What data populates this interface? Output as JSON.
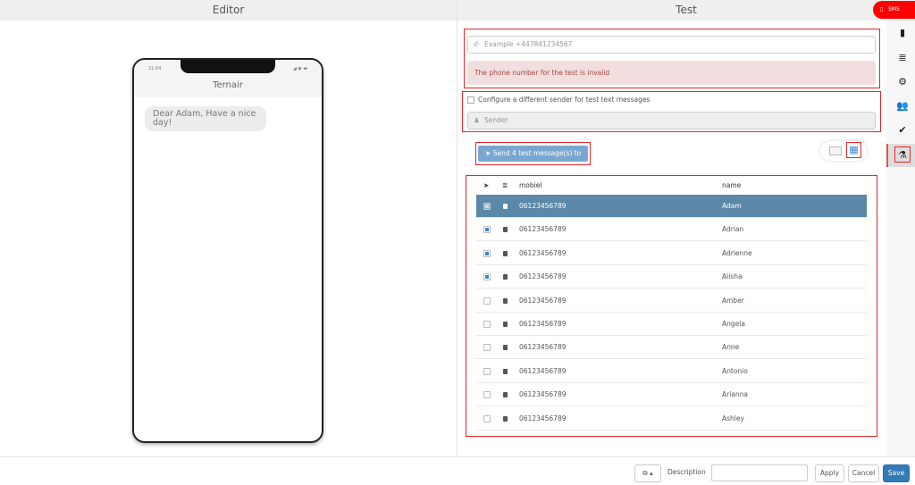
{
  "editor": {
    "title": "Editor",
    "phone": {
      "time": "21:04",
      "app_name": "Ternair",
      "message": "Dear Adam, Have a nice day!"
    }
  },
  "test": {
    "title": "Test",
    "channel_badge": "SMS",
    "phone_placeholder": "Example +447841234567",
    "error": "The phone number for the test is invalid",
    "sender_checkbox_label": "Configure a different sender for test text messages",
    "sender_placeholder": "Sender",
    "send_button": "Send 4 test message(s) to ...",
    "table": {
      "columns": [
        "mobiel",
        "name"
      ],
      "rows": [
        {
          "mobiel": "06123456789",
          "name": "Adam",
          "checked": true,
          "selected": true
        },
        {
          "mobiel": "06123456789",
          "name": "Adrian",
          "checked": true
        },
        {
          "mobiel": "06123456789",
          "name": "Adrienne",
          "checked": true
        },
        {
          "mobiel": "06123456789",
          "name": "Alisha",
          "checked": true
        },
        {
          "mobiel": "06123456789",
          "name": "Amber",
          "checked": false
        },
        {
          "mobiel": "06123456789",
          "name": "Angela",
          "checked": false
        },
        {
          "mobiel": "06123456789",
          "name": "Anne",
          "checked": false
        },
        {
          "mobiel": "06123456789",
          "name": "Antonio",
          "checked": false
        },
        {
          "mobiel": "06123456789",
          "name": "Arianna",
          "checked": false
        },
        {
          "mobiel": "06123456789",
          "name": "Ashley",
          "checked": false
        }
      ]
    }
  },
  "sidebar": [
    "file-icon",
    "database-icon",
    "gear-icon",
    "users-icon",
    "check-icon",
    "flask-icon"
  ],
  "footer": {
    "description_label": "Description",
    "description_value": "",
    "apply": "Apply",
    "cancel": "Cancel",
    "save": "Save"
  },
  "colors": {
    "accent": "#337ab7",
    "selected_row": "#5b87a8",
    "error_bg": "#f2dede",
    "error_text": "#a94442",
    "highlight": "#e8262b"
  }
}
